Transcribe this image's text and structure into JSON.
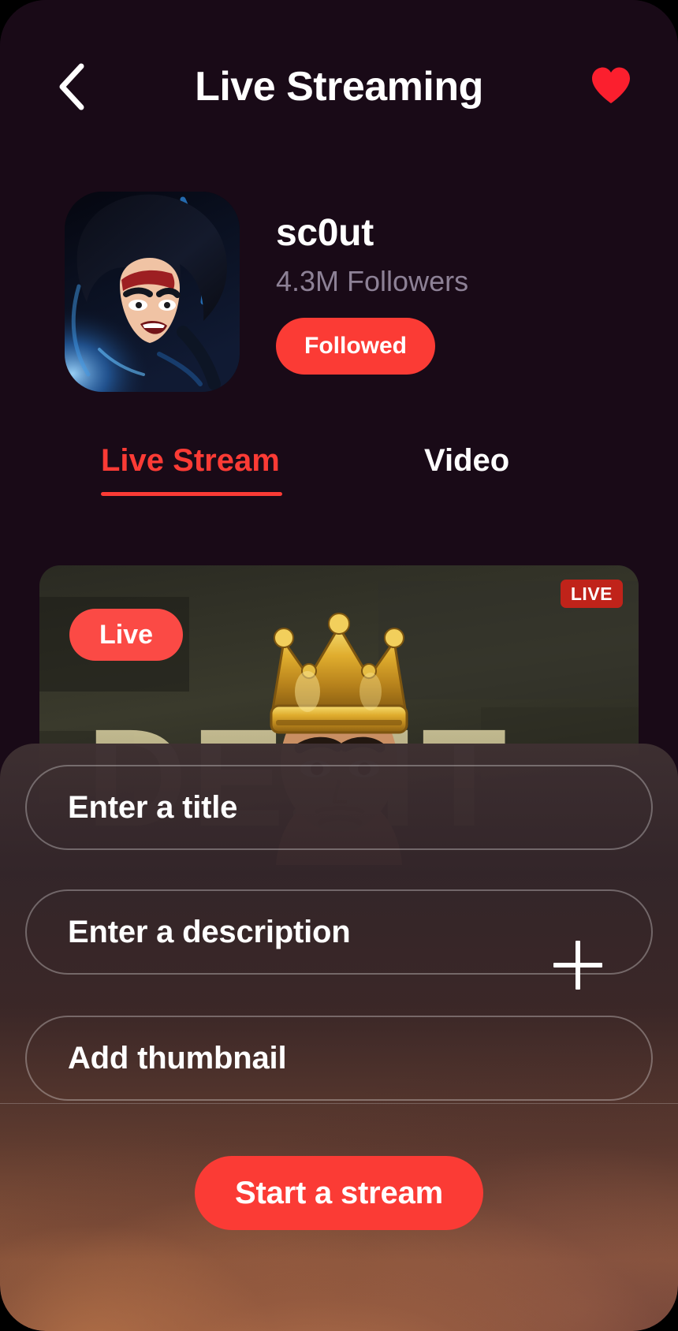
{
  "header": {
    "back_icon": "chevron-left-icon",
    "title": "Live Streaming",
    "favorite_icon": "heart-icon",
    "favorite_color": "#fb1f2e"
  },
  "profile": {
    "avatar_icon": "anime-character-avatar",
    "username": "sc0ut",
    "followers": "4.3M Followers",
    "follow_button_label": "Followed",
    "follow_button_color": "#fb3b35"
  },
  "tabs": [
    {
      "label": "Live Stream",
      "active": true,
      "color": "#fb3b35"
    },
    {
      "label": "Video",
      "active": false,
      "color": "#ffffff"
    }
  ],
  "stream_card": {
    "live_pill_label": "Live",
    "live_badge_label": "LIVE",
    "thumbnail_icon": "crowned-streamer-thumbnail",
    "overlay_text": "DEZ"
  },
  "sheet": {
    "title_field": {
      "placeholder": "Enter a title",
      "value": ""
    },
    "description_field": {
      "placeholder": "Enter a description",
      "value": "",
      "add_icon": "plus-icon"
    },
    "thumbnail_field": {
      "placeholder": "Add thumbnail",
      "value": ""
    },
    "start_button_label": "Start a stream",
    "start_button_color": "#fb3b35"
  }
}
